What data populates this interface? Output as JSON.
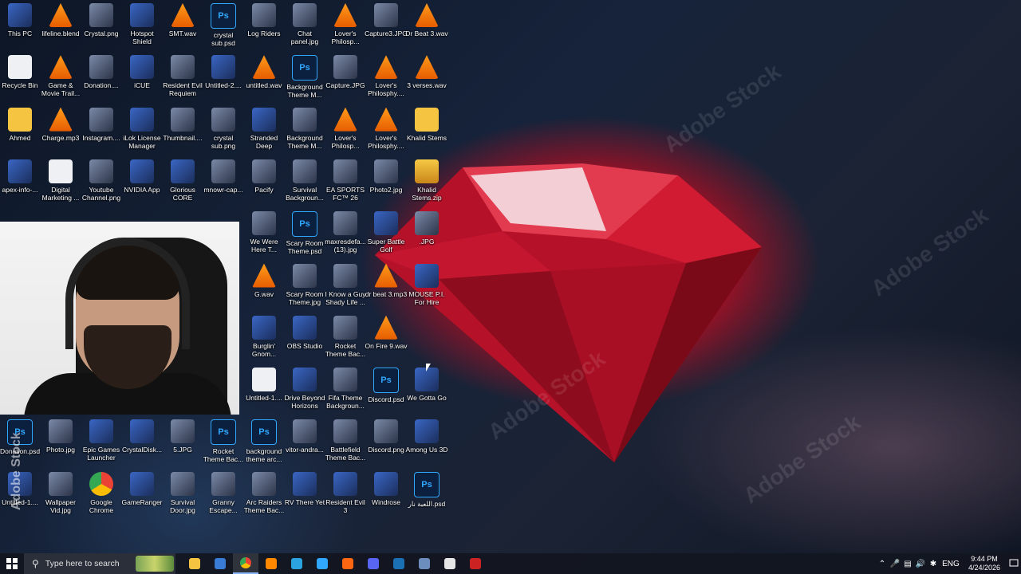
{
  "wallpaper": {
    "watermark": "Adobe Stock",
    "accent": "#c8102e"
  },
  "desktop_icons": [
    {
      "label": "This PC",
      "type": "app",
      "col": 0,
      "row": 0
    },
    {
      "label": "lifeline.blend",
      "type": "vlc",
      "col": 1,
      "row": 0
    },
    {
      "label": "Crystal.png",
      "type": "img",
      "col": 2,
      "row": 0
    },
    {
      "label": "Hotspot Shield",
      "type": "app",
      "col": 3,
      "row": 0
    },
    {
      "label": "SMT.wav",
      "type": "vlc",
      "col": 4,
      "row": 0
    },
    {
      "label": "crystal sub.psd",
      "type": "ps",
      "col": 5,
      "row": 0
    },
    {
      "label": "Log Riders",
      "type": "img",
      "col": 6,
      "row": 0
    },
    {
      "label": "Chat panel.jpg",
      "type": "img",
      "col": 7,
      "row": 0
    },
    {
      "label": "Lover's Philosp...",
      "type": "vlc",
      "col": 8,
      "row": 0
    },
    {
      "label": "Capture3.JPG",
      "type": "img",
      "col": 9,
      "row": 0
    },
    {
      "label": "Dr Beat 3.wav",
      "type": "vlc",
      "col": 10,
      "row": 0
    },
    {
      "label": "Recycle Bin",
      "type": "doc",
      "col": 0,
      "row": 1
    },
    {
      "label": "Game & Movie Trail...",
      "type": "vlc",
      "col": 1,
      "row": 1
    },
    {
      "label": "Donation....",
      "type": "img",
      "col": 2,
      "row": 1
    },
    {
      "label": "iCUE",
      "type": "app",
      "col": 3,
      "row": 1
    },
    {
      "label": "Resident Evil Requiem",
      "type": "img",
      "col": 4,
      "row": 1
    },
    {
      "label": "Untitled-2....",
      "type": "app",
      "col": 5,
      "row": 1
    },
    {
      "label": "untitled.wav",
      "type": "vlc",
      "col": 6,
      "row": 1
    },
    {
      "label": "Background Theme M...",
      "type": "ps",
      "col": 7,
      "row": 1
    },
    {
      "label": "Capture.JPG",
      "type": "img",
      "col": 8,
      "row": 1
    },
    {
      "label": "Lover's Philosphy....",
      "type": "vlc",
      "col": 9,
      "row": 1
    },
    {
      "label": "3 verses.wav",
      "type": "vlc",
      "col": 10,
      "row": 1
    },
    {
      "label": "Ahmed",
      "type": "folder",
      "col": 0,
      "row": 2
    },
    {
      "label": "Charge.mp3",
      "type": "vlc",
      "col": 1,
      "row": 2
    },
    {
      "label": "Instagram....",
      "type": "img",
      "col": 2,
      "row": 2
    },
    {
      "label": "iLok License Manager",
      "type": "app",
      "col": 3,
      "row": 2
    },
    {
      "label": "Thumbnail....",
      "type": "img",
      "col": 4,
      "row": 2
    },
    {
      "label": "crystal sub.png",
      "type": "img",
      "col": 5,
      "row": 2
    },
    {
      "label": "Stranded Deep",
      "type": "app",
      "col": 6,
      "row": 2
    },
    {
      "label": "Background Theme M...",
      "type": "img",
      "col": 7,
      "row": 2
    },
    {
      "label": "Lover's Philosp...",
      "type": "vlc",
      "col": 8,
      "row": 2
    },
    {
      "label": "Lover's Philosphy....",
      "type": "vlc",
      "col": 9,
      "row": 2
    },
    {
      "label": "Khalid Stems",
      "type": "folder",
      "col": 10,
      "row": 2
    },
    {
      "label": "apex-info-...",
      "type": "app",
      "col": 0,
      "row": 3
    },
    {
      "label": "Digital Marketing ...",
      "type": "doc",
      "col": 1,
      "row": 3
    },
    {
      "label": "Youtube Channel.png",
      "type": "img",
      "col": 2,
      "row": 3
    },
    {
      "label": "NVIDIA App",
      "type": "app",
      "col": 3,
      "row": 3
    },
    {
      "label": "Glorious CORE",
      "type": "app",
      "col": 4,
      "row": 3
    },
    {
      "label": "mnowr-cap...",
      "type": "img",
      "col": 5,
      "row": 3
    },
    {
      "label": "Pacify",
      "type": "img",
      "col": 6,
      "row": 3
    },
    {
      "label": "Survival Backgroun...",
      "type": "img",
      "col": 7,
      "row": 3
    },
    {
      "label": "EA SPORTS FC™ 26",
      "type": "img",
      "col": 8,
      "row": 3
    },
    {
      "label": "Photo2.jpg",
      "type": "img",
      "col": 9,
      "row": 3
    },
    {
      "label": "Khalid Stems.zip",
      "type": "zip",
      "col": 10,
      "row": 3
    },
    {
      "label": "We Were Here T...",
      "type": "img",
      "col": 6,
      "row": 4
    },
    {
      "label": "Scary Room Theme.psd",
      "type": "ps",
      "col": 7,
      "row": 4
    },
    {
      "label": "maxresdefa... (13).jpg",
      "type": "img",
      "col": 8,
      "row": 4
    },
    {
      "label": "Super Battle Golf",
      "type": "app",
      "col": 9,
      "row": 4
    },
    {
      "label": ".JPG",
      "type": "img",
      "col": 10,
      "row": 4
    },
    {
      "label": "G.wav",
      "type": "vlc",
      "col": 6,
      "row": 5
    },
    {
      "label": "Scary Room Theme.jpg",
      "type": "img",
      "col": 7,
      "row": 5
    },
    {
      "label": "I Know a Guy Shady Life ...",
      "type": "img",
      "col": 8,
      "row": 5
    },
    {
      "label": "dr beat 3.mp3",
      "type": "vlc",
      "col": 9,
      "row": 5
    },
    {
      "label": "MOUSE P.I. For Hire",
      "type": "app",
      "col": 10,
      "row": 5
    },
    {
      "label": "Burglin' Gnom...",
      "type": "app",
      "col": 6,
      "row": 6
    },
    {
      "label": "OBS Studio",
      "type": "app",
      "col": 7,
      "row": 6
    },
    {
      "label": "Rocket Theme Bac...",
      "type": "img",
      "col": 8,
      "row": 6
    },
    {
      "label": "On Fire 9.wav",
      "type": "vlc",
      "col": 9,
      "row": 6
    },
    {
      "label": "Untitled-1....",
      "type": "doc",
      "col": 6,
      "row": 7
    },
    {
      "label": "Drive Beyond Horizons",
      "type": "app",
      "col": 7,
      "row": 7
    },
    {
      "label": "Fifa Theme Backgroun...",
      "type": "img",
      "col": 8,
      "row": 7
    },
    {
      "label": "Discord.psd",
      "type": "ps",
      "col": 9,
      "row": 7
    },
    {
      "label": "We Gotta Go",
      "type": "app",
      "col": 10,
      "row": 7
    },
    {
      "label": "Donation.psd",
      "type": "ps",
      "col": 0,
      "row": 8
    },
    {
      "label": "Photo.jpg",
      "type": "img",
      "col": 1,
      "row": 8
    },
    {
      "label": "Epic Games Launcher",
      "type": "app",
      "col": 2,
      "row": 8
    },
    {
      "label": "CrystalDisk...",
      "type": "app",
      "col": 3,
      "row": 8
    },
    {
      "label": "5.JPG",
      "type": "img",
      "col": 4,
      "row": 8
    },
    {
      "label": "Rocket Theme Bac...",
      "type": "ps",
      "col": 5,
      "row": 8
    },
    {
      "label": "background theme arc...",
      "type": "ps",
      "col": 6,
      "row": 8
    },
    {
      "label": "vitor-andra...",
      "type": "img",
      "col": 7,
      "row": 8
    },
    {
      "label": "Battlefield Theme Bac...",
      "type": "img",
      "col": 8,
      "row": 8
    },
    {
      "label": "Discord.png",
      "type": "img",
      "col": 9,
      "row": 8
    },
    {
      "label": "Among Us 3D",
      "type": "app",
      "col": 10,
      "row": 8
    },
    {
      "label": "Untitled-1....",
      "type": "app",
      "col": 0,
      "row": 9
    },
    {
      "label": "Wallpaper Vid.jpg",
      "type": "img",
      "col": 1,
      "row": 9
    },
    {
      "label": "Google Chrome",
      "type": "chrome",
      "col": 2,
      "row": 9
    },
    {
      "label": "GameRanger",
      "type": "app",
      "col": 3,
      "row": 9
    },
    {
      "label": "Survival Door.jpg",
      "type": "img",
      "col": 4,
      "row": 9
    },
    {
      "label": "Granny Escape...",
      "type": "img",
      "col": 5,
      "row": 9
    },
    {
      "label": "Arc Raiders Theme Bac...",
      "type": "img",
      "col": 6,
      "row": 9
    },
    {
      "label": "RV There Yet",
      "type": "app",
      "col": 7,
      "row": 9
    },
    {
      "label": "Resident Evil 3",
      "type": "app",
      "col": 8,
      "row": 9
    },
    {
      "label": "Windrose",
      "type": "app",
      "col": 9,
      "row": 9
    },
    {
      "label": "اللعبة نار.psd",
      "type": "ps",
      "col": 10,
      "row": 9
    }
  ],
  "taskbar": {
    "search_placeholder": "Type here to search",
    "pinned": [
      {
        "name": "file-explorer-icon",
        "color": "#f5c542"
      },
      {
        "name": "calculator-icon",
        "color": "#3a7bd5"
      },
      {
        "name": "chrome-icon",
        "color": "#ea4335",
        "active": true
      },
      {
        "name": "vlc-icon",
        "color": "#ff8800"
      },
      {
        "name": "telegram-icon",
        "color": "#2aa3e0"
      },
      {
        "name": "photoshop-icon",
        "color": "#31a8ff"
      },
      {
        "name": "firefox-icon",
        "color": "#ff6611"
      },
      {
        "name": "discord-icon",
        "color": "#5865f2"
      },
      {
        "name": "steam-icon",
        "color": "#1b6fb3"
      },
      {
        "name": "git-icon",
        "color": "#6c8ebf"
      },
      {
        "name": "capcut-icon",
        "color": "#e6e6e6"
      },
      {
        "name": "obs-icon",
        "color": "#cc2222"
      }
    ],
    "tray": {
      "language": "ENG",
      "time": "9:44 PM",
      "date": "4/24/2026"
    }
  }
}
